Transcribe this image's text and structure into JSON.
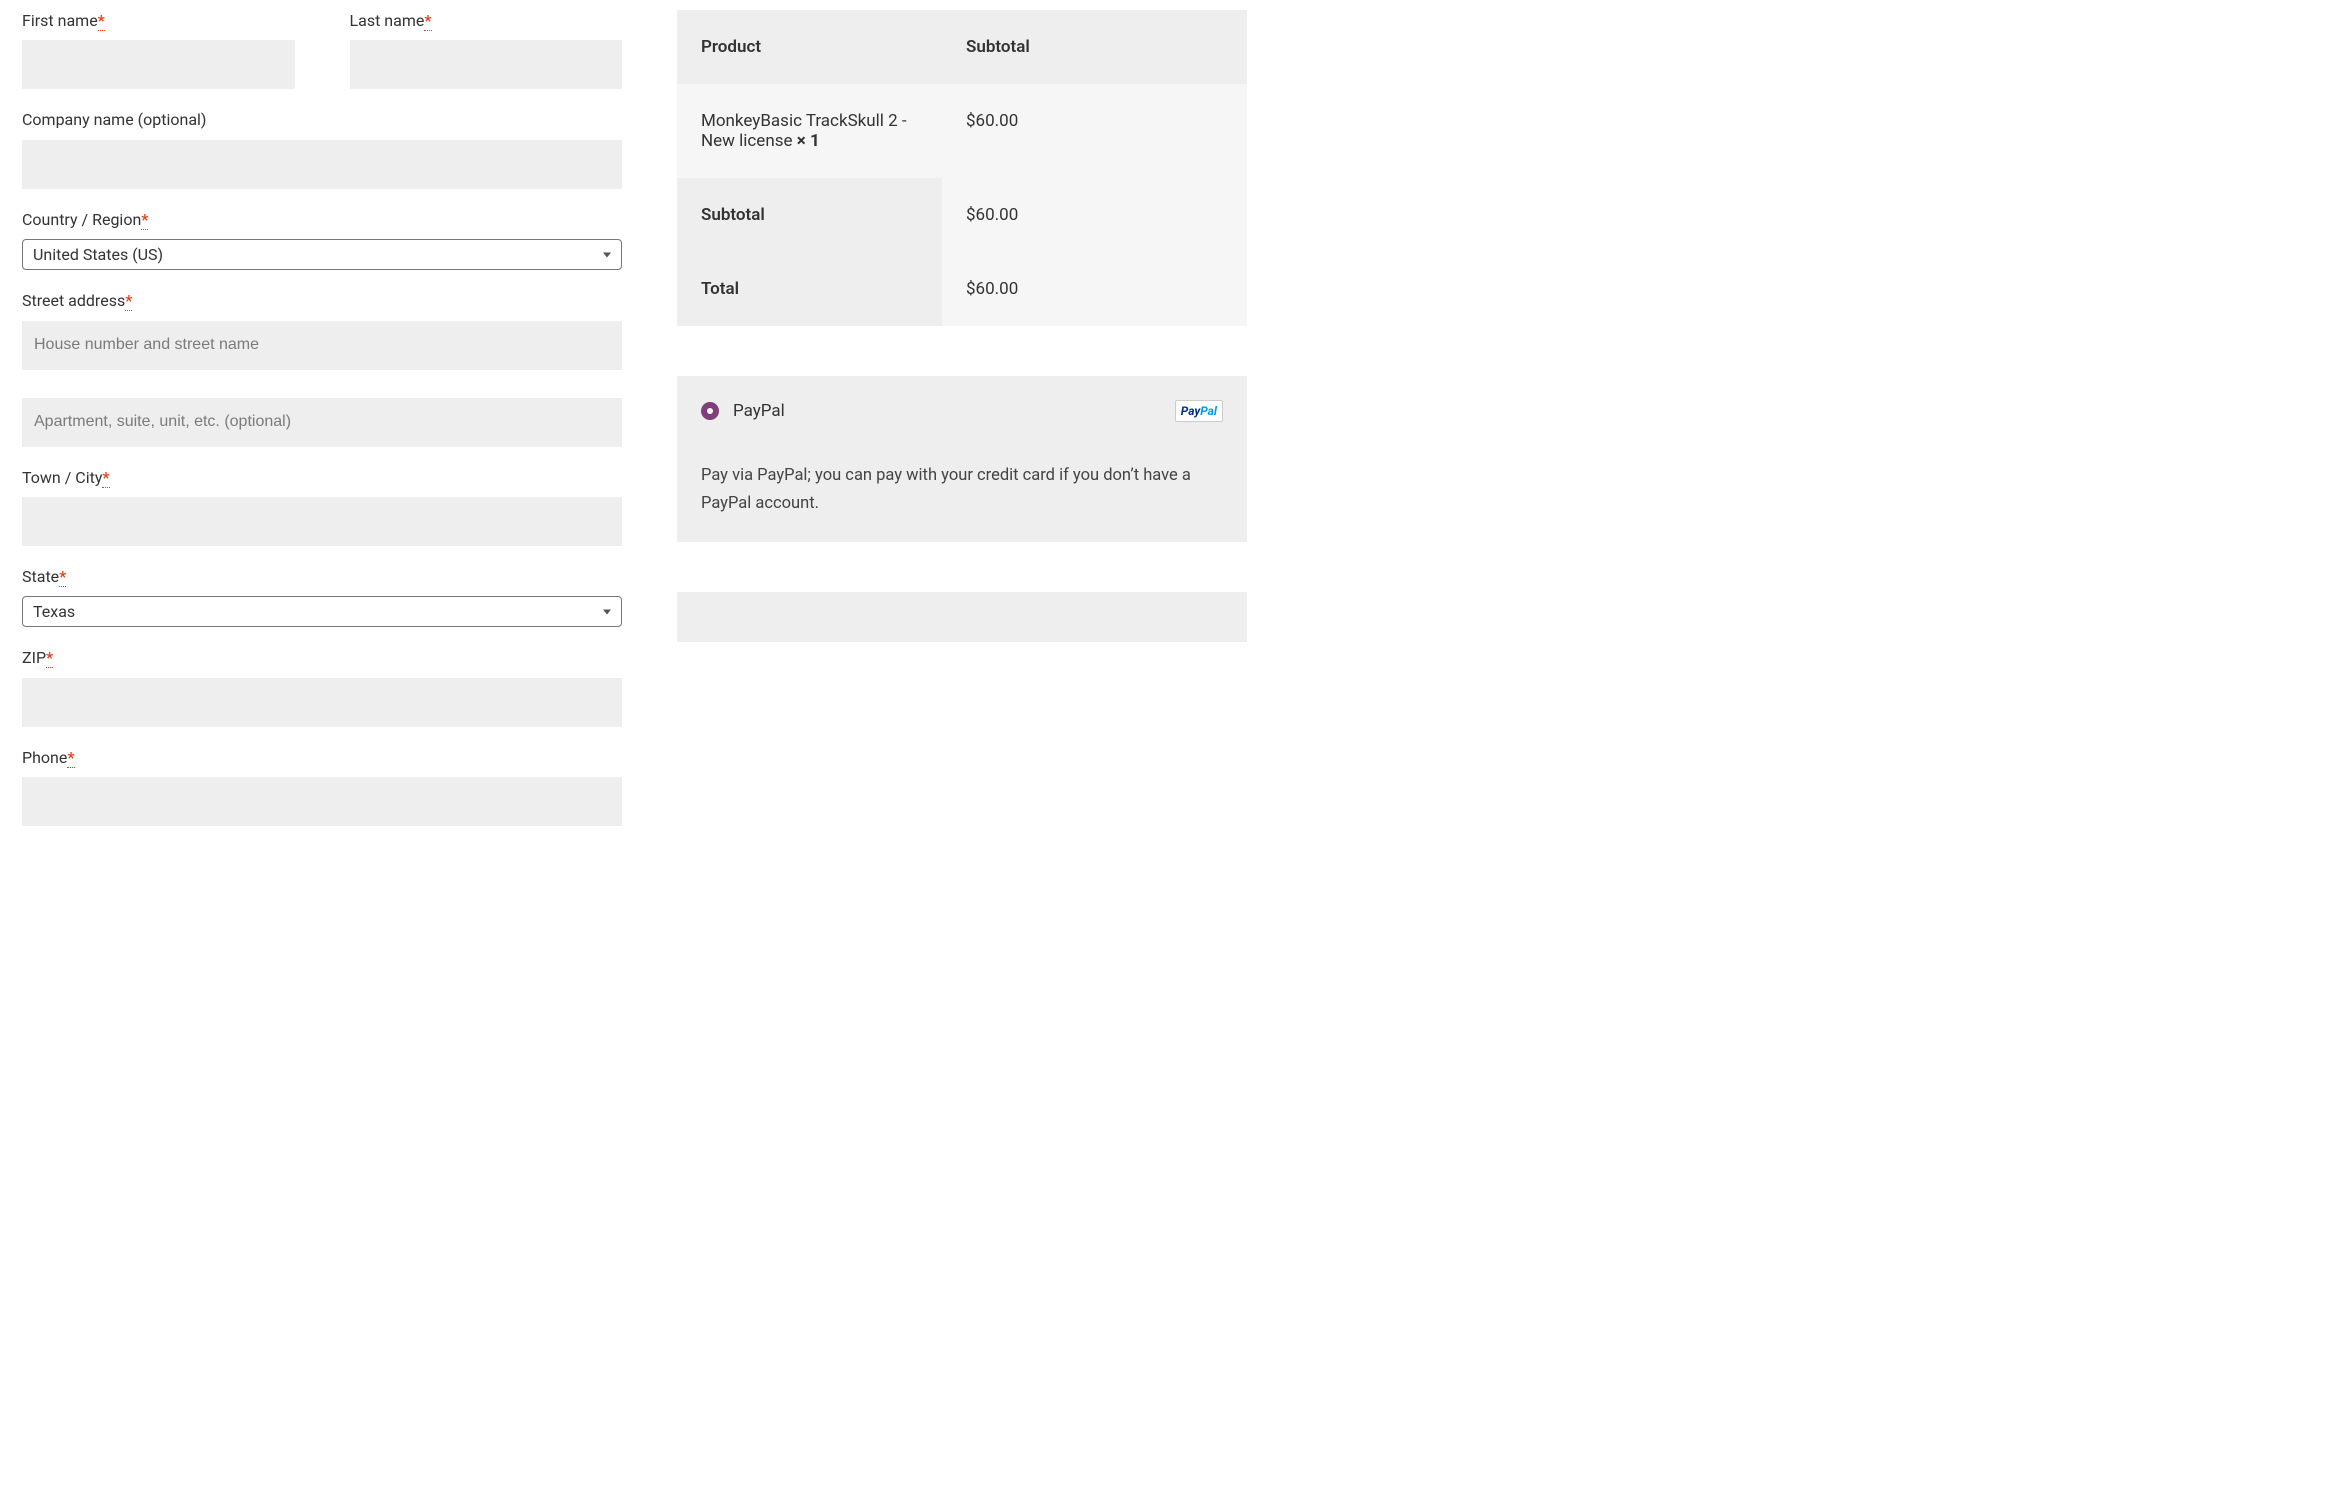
{
  "billing": {
    "first_name_label": "First name",
    "last_name_label": "Last name",
    "company_label": "Company name (optional)",
    "country_label": "Country / Region",
    "country_value": "United States (US)",
    "street_label": "Street address",
    "street1_placeholder": "House number and street name",
    "street2_placeholder": "Apartment, suite, unit, etc. (optional)",
    "city_label": "Town / City",
    "state_label": "State",
    "state_value": "Texas",
    "zip_label": "ZIP",
    "phone_label": "Phone"
  },
  "required_mark": "*",
  "order": {
    "head_product": "Product",
    "head_subtotal": "Subtotal",
    "item_name": "MonkeyBasic TrackSkull 2 - New license ",
    "item_qty": "× 1",
    "item_price": "$60.00",
    "subtotal_label": "Subtotal",
    "subtotal_value": "$60.00",
    "total_label": "Total",
    "total_value": "$60.00"
  },
  "payment": {
    "method_label": "PayPal",
    "logo_p1": "Pay",
    "logo_p2": "Pal",
    "description": "Pay via PayPal; you can pay with your credit card if you don’t have a PayPal account."
  }
}
